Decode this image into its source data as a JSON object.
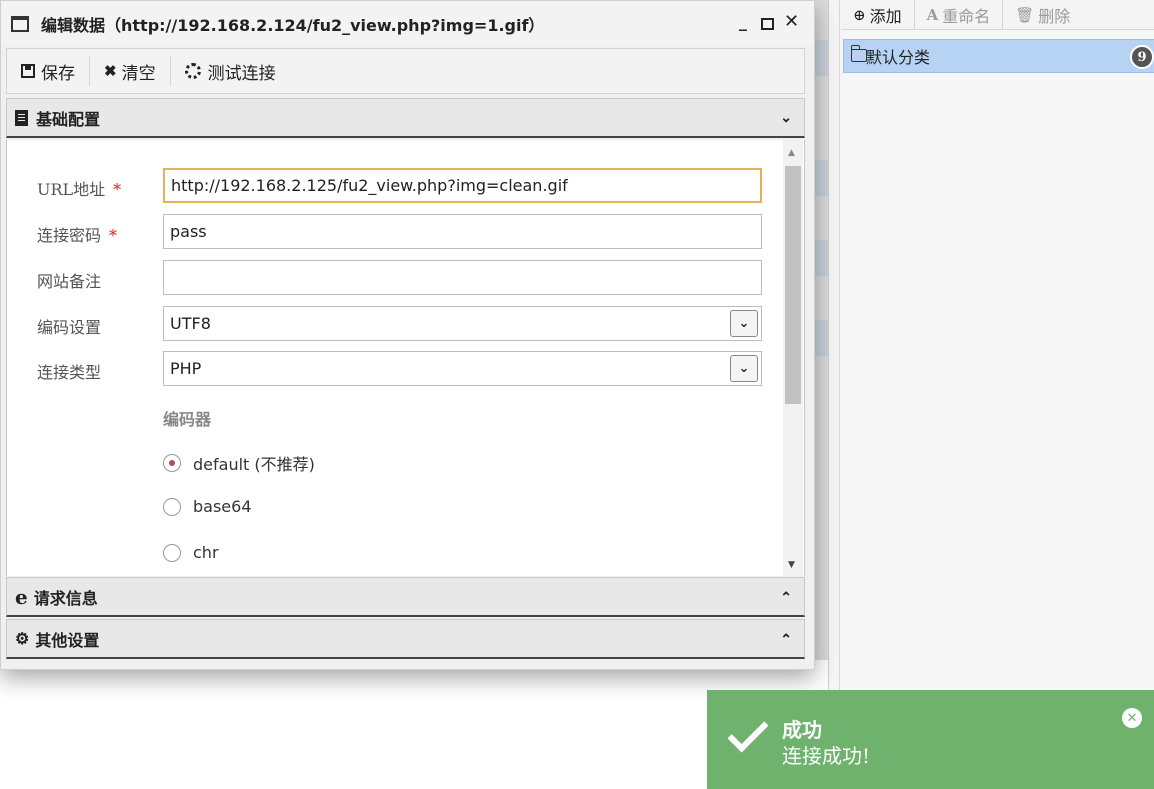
{
  "dialog": {
    "title": "编辑数据（http://192.168.2.124/fu2_view.php?img=1.gif）",
    "controls": {
      "minimize": "_",
      "close": "✕"
    }
  },
  "toolbar": {
    "save_label": "保存",
    "clear_label": "清空",
    "test_label": "测试连接"
  },
  "sections": {
    "basic": "基础配置",
    "request": "请求信息",
    "other": "其他设置"
  },
  "form": {
    "url_label": "URL地址",
    "url_value": "http://192.168.2.125/fu2_view.php?img=clean.gif",
    "password_label": "连接密码",
    "password_value": "pass",
    "note_label": "网站备注",
    "note_value": "",
    "encoding_label": "编码设置",
    "encoding_value": "UTF8",
    "type_label": "连接类型",
    "type_value": "PHP",
    "required_mark": "*",
    "encoder_label": "编码器",
    "encoders": [
      {
        "label": "default (不推荐)",
        "checked": true
      },
      {
        "label": "base64",
        "checked": false
      },
      {
        "label": "chr",
        "checked": false
      }
    ]
  },
  "right_panel": {
    "add_label": "添加",
    "rename_label": "重命名",
    "delete_label": "删除",
    "category_label": "默认分类",
    "category_count": "9"
  },
  "toast": {
    "title": "成功",
    "message": "连接成功!"
  },
  "colors": {
    "toast_bg": "#6eb26e",
    "selected_item": "#b7d3f4",
    "focus_border": "#e0b55a",
    "required": "#d62020"
  }
}
